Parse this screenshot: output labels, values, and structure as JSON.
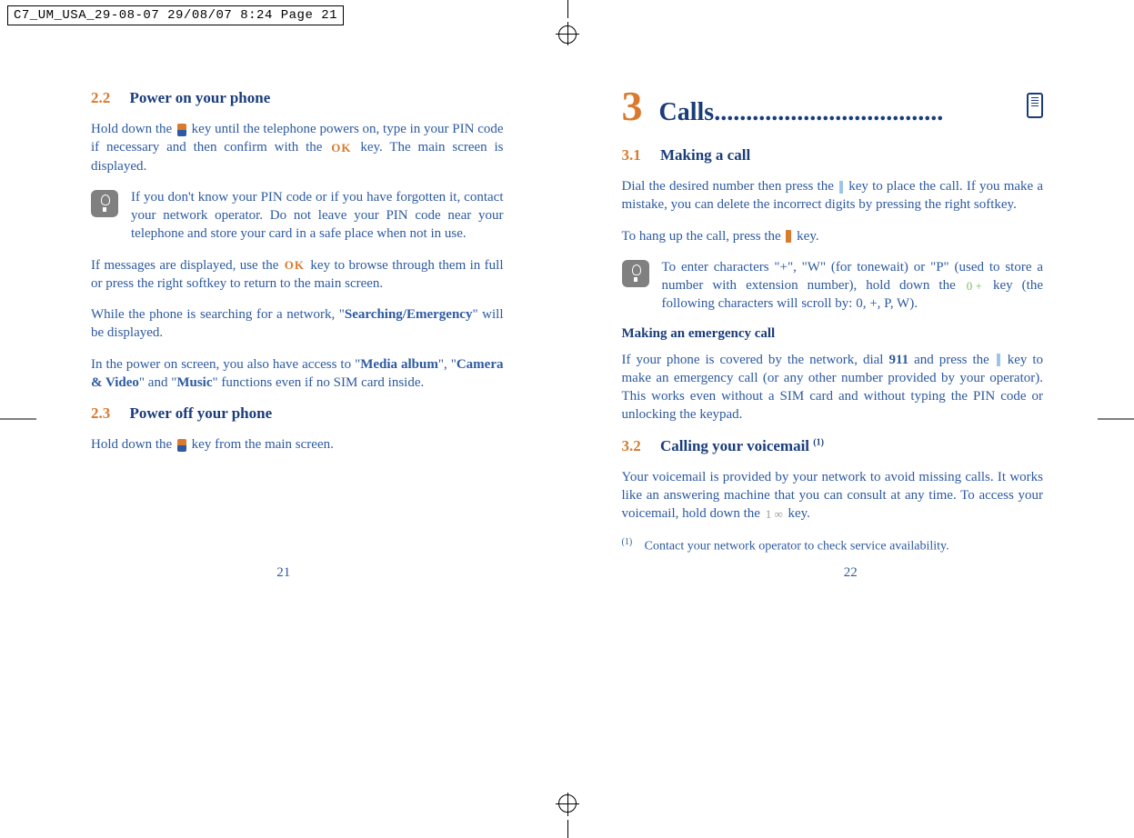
{
  "slug": "C7_UM_USA_29-08-07  29/08/07  8:24  Page 21",
  "left": {
    "s22": {
      "num": "2.2",
      "title": "Power on your phone"
    },
    "p1a": "Hold down the ",
    "p1b": " key until the telephone powers on, type in your PIN code if necessary and then confirm with the ",
    "p1c": " key. The main screen is displayed.",
    "tip1": "If you don't know your PIN code or if you have forgotten it, contact your network operator. Do not leave your PIN code near your telephone and store your card in a safe place when not in use.",
    "p2a": "If messages are displayed, use the ",
    "p2b": " key to browse through them in full or press the right softkey to return to the main screen.",
    "p3a": "While the phone is searching for a network, \"",
    "p3b": "Searching/Emergency",
    "p3c": "\" will be displayed.",
    "p4a": "In the power on screen, you also have access to \"",
    "p4b": "Media album",
    "p4c": "\", \"",
    "p4d": "Camera & Video",
    "p4e": "\" and \"",
    "p4f": "Music",
    "p4g": "\" functions even if no SIM card inside.",
    "s23": {
      "num": "2.3",
      "title": "Power off your phone"
    },
    "p5a": "Hold down the ",
    "p5b": " key from the main screen.",
    "pagenum": "21"
  },
  "right": {
    "chapter": {
      "num": "3",
      "title": "Calls",
      "dots": "...................................."
    },
    "s31": {
      "num": "3.1",
      "title": "Making a call"
    },
    "p1a": "Dial the desired number then press the ",
    "p1b": " key to place the call. If you make a mistake, you can delete the incorrect digits by pressing the right softkey.",
    "p2a": "To hang up the call, press the ",
    "p2b": " key.",
    "tip1a": "To enter characters \"+\", \"W\" (for tonewait) or \"P\" (used to store a number with extension number), hold down the ",
    "tip1b": " key (the following characters will scroll by: 0, +, P, W).",
    "key0": "0 +",
    "sub1": "Making an emergency call",
    "p3a": "If your phone is covered by the network, dial ",
    "p3b": "911",
    "p3c": " and press the ",
    "p3d": " key to make an emergency call (or any other number provided by your operator). This works even without a SIM card and without typing the PIN code or unlocking the keypad.",
    "s32": {
      "num": "3.2",
      "title": "Calling your voicemail ",
      "sup": "(1)"
    },
    "p4a": "Your voicemail is provided by your network to avoid missing calls. It works like an answering machine that you can consult at any time. To access your voicemail, hold down the ",
    "p4b": " key.",
    "key1": "1 ∞",
    "footnote_sup": "(1)",
    "footnote": "Contact your network operator to check service availability.",
    "pagenum": "22"
  },
  "ok_label": "OK"
}
